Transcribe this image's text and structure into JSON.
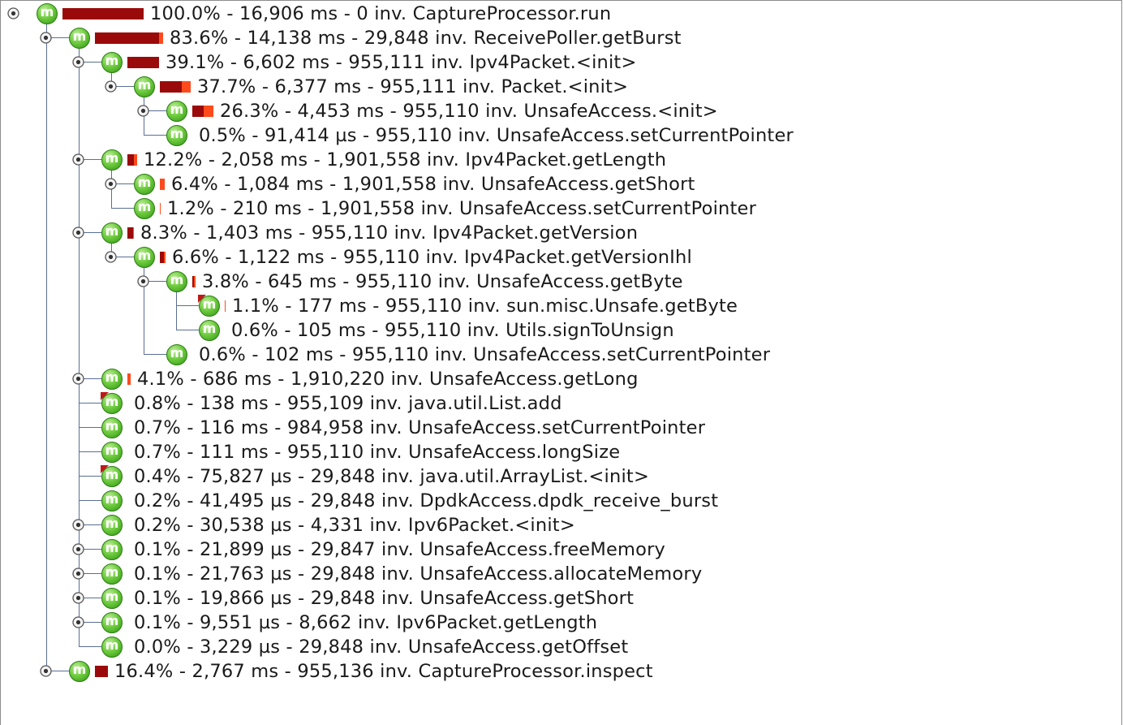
{
  "call_tree": {
    "nodes": [
      {
        "depth": 0,
        "label": "100.0% - 16,906 ms - 0 inv. CaptureProcessor.run",
        "percent": 100.0,
        "self_percent": 0.0,
        "expandable": true,
        "icon": "method-icon",
        "last": true
      },
      {
        "depth": 1,
        "label": "83.6% - 14,138 ms - 29,848 inv. ReceivePoller.getBurst",
        "percent": 83.6,
        "self_percent": 4.5,
        "expandable": true,
        "icon": "method-icon",
        "last": false
      },
      {
        "depth": 2,
        "label": "39.1% - 6,602 ms - 955,111 inv. Ipv4Packet.<init>",
        "percent": 39.1,
        "self_percent": 0.0,
        "expandable": true,
        "icon": "method-icon",
        "last": false
      },
      {
        "depth": 3,
        "label": "37.7% - 6,377 ms - 955,111 inv. Packet.<init>",
        "percent": 37.7,
        "self_percent": 11.0,
        "expandable": true,
        "icon": "method-icon",
        "last": true
      },
      {
        "depth": 4,
        "label": "26.3% - 4,453 ms - 955,110 inv. UnsafeAccess.<init>",
        "percent": 26.3,
        "self_percent": 12.0,
        "expandable": true,
        "icon": "method-icon",
        "last": false
      },
      {
        "depth": 4,
        "label": "0.5% - 91,414 µs - 955,110 inv. UnsafeAccess.setCurrentPointer",
        "percent": 0.5,
        "self_percent": 0.5,
        "expandable": false,
        "icon": "method-icon",
        "last": true
      },
      {
        "depth": 2,
        "label": "12.2% - 2,058 ms - 1,901,558 inv. Ipv4Packet.getLength",
        "percent": 12.2,
        "self_percent": 4.0,
        "expandable": true,
        "icon": "method-icon",
        "last": false
      },
      {
        "depth": 3,
        "label": "6.4% - 1,084 ms - 1,901,558 inv. UnsafeAccess.getShort",
        "percent": 6.4,
        "self_percent": 6.4,
        "expandable": true,
        "icon": "method-icon",
        "last": false
      },
      {
        "depth": 3,
        "label": "1.2% - 210 ms - 1,901,558 inv. UnsafeAccess.setCurrentPointer",
        "percent": 1.2,
        "self_percent": 1.2,
        "expandable": false,
        "icon": "method-icon",
        "last": true
      },
      {
        "depth": 2,
        "label": "8.3% - 1,403 ms - 955,110 inv. Ipv4Packet.getVersion",
        "percent": 8.3,
        "self_percent": 1.0,
        "expandable": true,
        "icon": "method-icon",
        "last": false
      },
      {
        "depth": 3,
        "label": "6.6% - 1,122 ms - 955,110 inv. Ipv4Packet.getVersionIhl",
        "percent": 6.6,
        "self_percent": 2.0,
        "expandable": true,
        "icon": "method-icon",
        "last": true
      },
      {
        "depth": 4,
        "label": "3.8% - 645 ms - 955,110 inv. UnsafeAccess.getByte",
        "percent": 3.8,
        "self_percent": 1.5,
        "expandable": true,
        "icon": "method-icon",
        "last": false
      },
      {
        "depth": 5,
        "label": "1.1% - 177 ms - 955,110 inv. sun.misc.Unsafe.getByte",
        "percent": 1.1,
        "self_percent": 1.1,
        "expandable": false,
        "icon": "method-icon",
        "flag": true,
        "last": false
      },
      {
        "depth": 5,
        "label": "0.6% - 105 ms - 955,110 inv. Utils.signToUnsign",
        "percent": 0.6,
        "self_percent": 0.6,
        "expandable": false,
        "icon": "method-icon",
        "last": true
      },
      {
        "depth": 4,
        "label": "0.6% - 102 ms - 955,110 inv. UnsafeAccess.setCurrentPointer",
        "percent": 0.6,
        "self_percent": 0.6,
        "expandable": false,
        "icon": "method-icon",
        "last": true
      },
      {
        "depth": 2,
        "label": "4.1% - 686 ms - 1,910,220 inv. UnsafeAccess.getLong",
        "percent": 4.1,
        "self_percent": 4.1,
        "expandable": true,
        "icon": "method-icon",
        "last": false
      },
      {
        "depth": 2,
        "label": "0.8% - 138 ms - 955,109 inv. java.util.List.add",
        "percent": 0.8,
        "self_percent": 0.8,
        "expandable": false,
        "icon": "method-icon",
        "flag": true,
        "last": false
      },
      {
        "depth": 2,
        "label": "0.7% - 116 ms - 984,958 inv. UnsafeAccess.setCurrentPointer",
        "percent": 0.7,
        "self_percent": 0.7,
        "expandable": false,
        "icon": "method-icon",
        "last": false
      },
      {
        "depth": 2,
        "label": "0.7% - 111 ms - 955,110 inv. UnsafeAccess.longSize",
        "percent": 0.7,
        "self_percent": 0.7,
        "expandable": false,
        "icon": "method-icon",
        "last": false
      },
      {
        "depth": 2,
        "label": "0.4% - 75,827 µs - 29,848 inv. java.util.ArrayList.<init>",
        "percent": 0.4,
        "self_percent": 0.4,
        "expandable": false,
        "icon": "method-icon",
        "flag": true,
        "last": false
      },
      {
        "depth": 2,
        "label": "0.2% - 41,495 µs - 29,848 inv. DpdkAccess.dpdk_receive_burst",
        "percent": 0.2,
        "self_percent": 0.2,
        "expandable": false,
        "icon": "method-icon",
        "last": false
      },
      {
        "depth": 2,
        "label": "0.2% - 30,538 µs - 4,331 inv. Ipv6Packet.<init>",
        "percent": 0.2,
        "self_percent": 0.2,
        "expandable": true,
        "icon": "method-icon",
        "last": false
      },
      {
        "depth": 2,
        "label": "0.1% - 21,899 µs - 29,847 inv. UnsafeAccess.freeMemory",
        "percent": 0.1,
        "self_percent": 0.1,
        "expandable": true,
        "icon": "method-icon",
        "last": false
      },
      {
        "depth": 2,
        "label": "0.1% - 21,763 µs - 29,848 inv. UnsafeAccess.allocateMemory",
        "percent": 0.1,
        "self_percent": 0.1,
        "expandable": true,
        "icon": "method-icon",
        "last": false
      },
      {
        "depth": 2,
        "label": "0.1% - 19,866 µs - 29,848 inv. UnsafeAccess.getShort",
        "percent": 0.1,
        "self_percent": 0.1,
        "expandable": true,
        "icon": "method-icon",
        "last": false
      },
      {
        "depth": 2,
        "label": "0.1% - 9,551 µs - 8,662 inv. Ipv6Packet.getLength",
        "percent": 0.1,
        "self_percent": 0.1,
        "expandable": true,
        "icon": "method-icon",
        "last": false
      },
      {
        "depth": 2,
        "label": "0.0% - 3,229 µs - 29,848 inv. UnsafeAccess.getOffset",
        "percent": 0.0,
        "self_percent": 0.0,
        "expandable": false,
        "icon": "method-icon",
        "last": true
      },
      {
        "depth": 1,
        "label": "16.4% - 2,767 ms - 955,136 inv. CaptureProcessor.inspect",
        "percent": 16.4,
        "self_percent": 0.0,
        "expandable": true,
        "icon": "method-icon",
        "last": true
      }
    ]
  },
  "colors": {
    "bar_inherent": "#9b0a0a",
    "bar_self": "#ff4a1c",
    "tree_line": "#5a6e96",
    "method_icon": "#4cb82c"
  }
}
